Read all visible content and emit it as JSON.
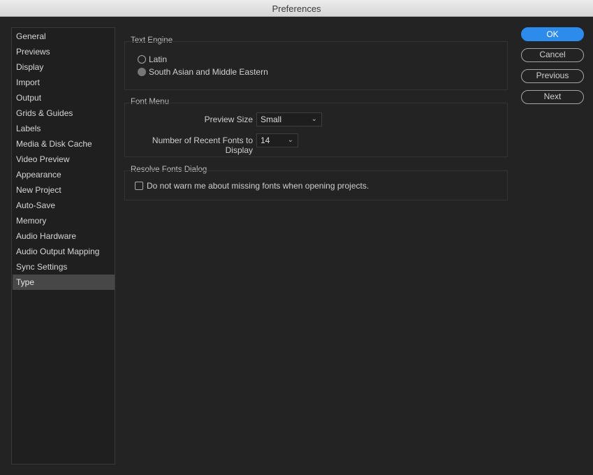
{
  "window": {
    "title": "Preferences"
  },
  "sidebar": {
    "items": [
      {
        "label": "General"
      },
      {
        "label": "Previews"
      },
      {
        "label": "Display"
      },
      {
        "label": "Import"
      },
      {
        "label": "Output"
      },
      {
        "label": "Grids & Guides"
      },
      {
        "label": "Labels"
      },
      {
        "label": "Media & Disk Cache"
      },
      {
        "label": "Video Preview"
      },
      {
        "label": "Appearance"
      },
      {
        "label": "New Project"
      },
      {
        "label": "Auto-Save"
      },
      {
        "label": "Memory"
      },
      {
        "label": "Audio Hardware"
      },
      {
        "label": "Audio Output Mapping"
      },
      {
        "label": "Sync Settings"
      },
      {
        "label": "Type",
        "selected": true
      }
    ]
  },
  "text_engine": {
    "title": "Text Engine",
    "options": [
      {
        "label": "Latin",
        "checked": false
      },
      {
        "label": "South Asian and Middle Eastern",
        "checked": true
      }
    ]
  },
  "font_menu": {
    "title": "Font Menu",
    "preview_size_label": "Preview Size",
    "preview_size_value": "Small",
    "recent_fonts_label": "Number of Recent Fonts to Display",
    "recent_fonts_value": "14"
  },
  "resolve_fonts": {
    "title": "Resolve Fonts Dialog",
    "checkbox_label": "Do not warn me about missing fonts when opening projects.",
    "checked": false
  },
  "buttons": {
    "ok": "OK",
    "cancel": "Cancel",
    "previous": "Previous",
    "next": "Next"
  },
  "colors": {
    "accent": "#2d8ceb",
    "background": "#232323",
    "selected_item": "#474747"
  }
}
